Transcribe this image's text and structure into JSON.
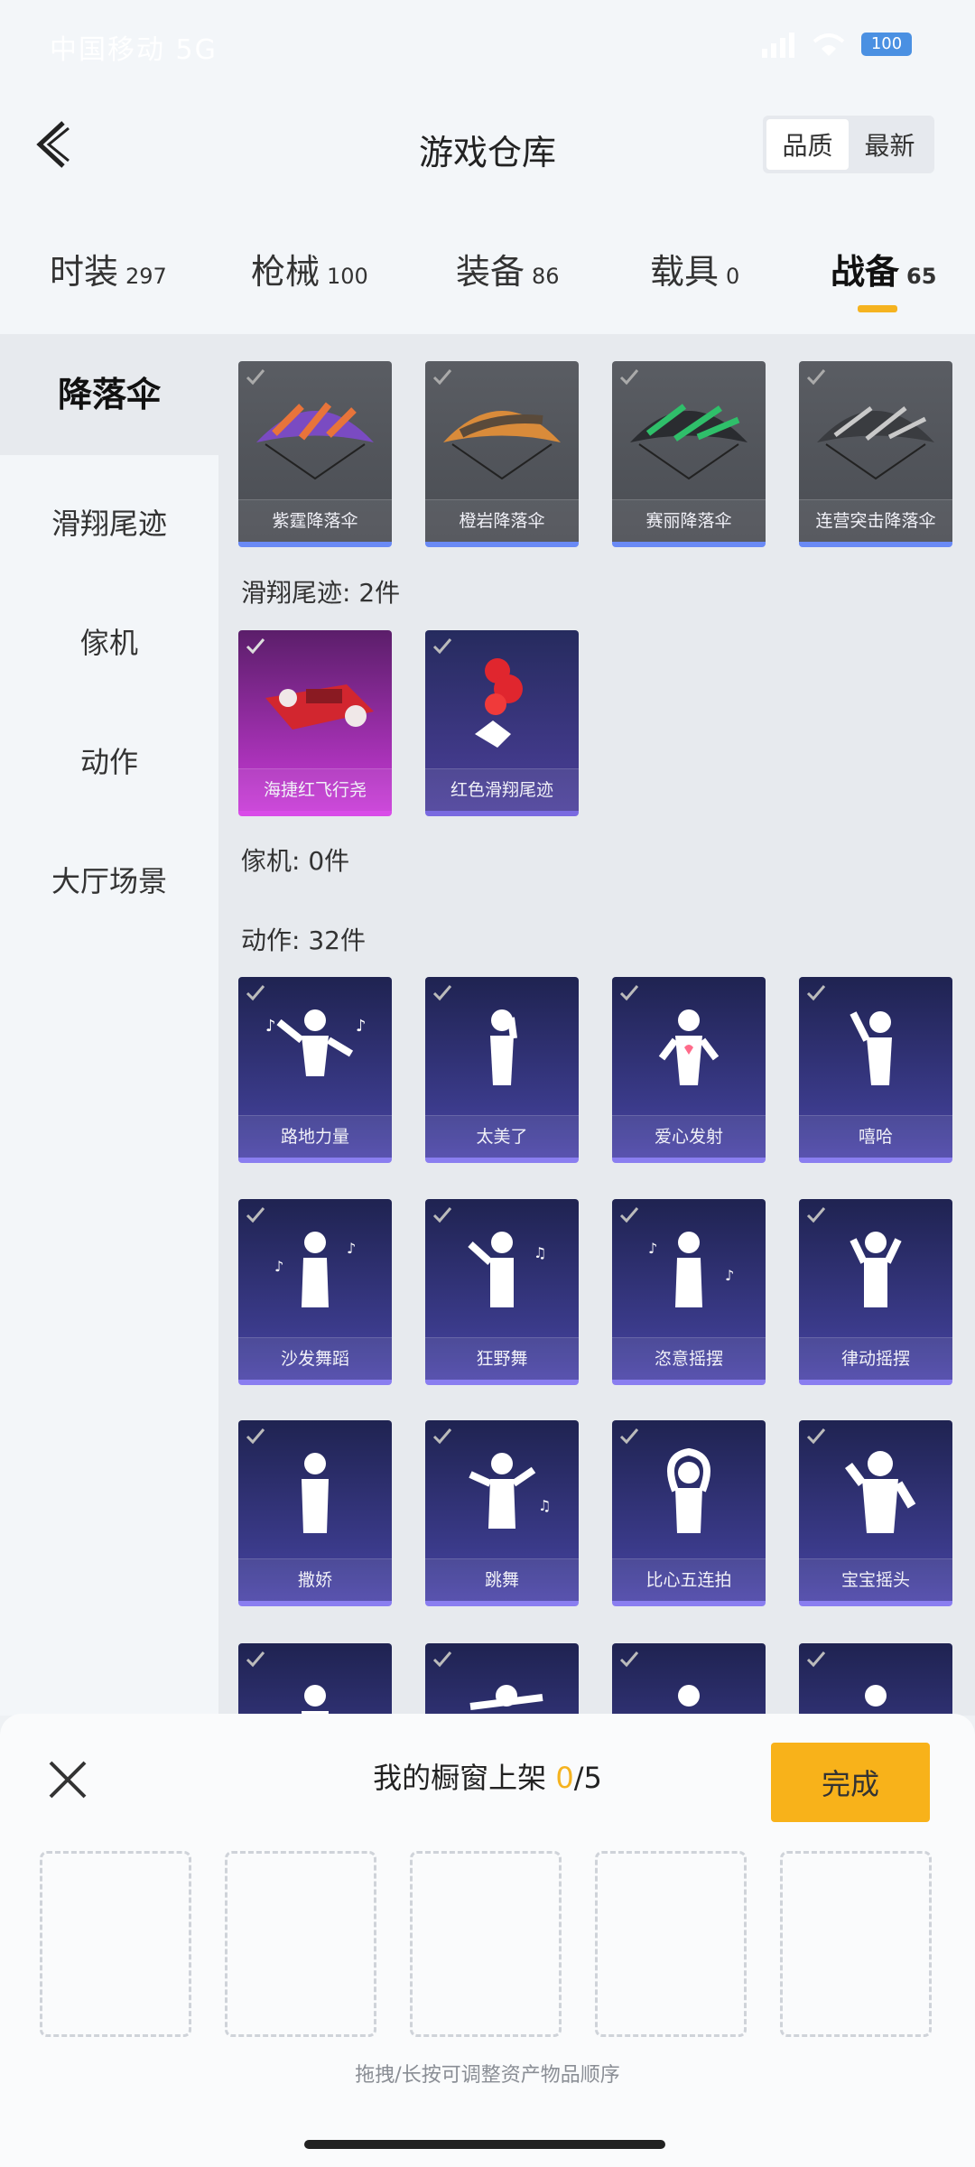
{
  "status": {
    "carrier": "中国移动 5G",
    "battery": "100"
  },
  "header": {
    "title": "游戏仓库",
    "sort": [
      "品质",
      "最新"
    ]
  },
  "categories": [
    {
      "label": "时装",
      "count": "297"
    },
    {
      "label": "枪械",
      "count": "100"
    },
    {
      "label": "装备",
      "count": "86"
    },
    {
      "label": "载具",
      "count": "0"
    },
    {
      "label": "战备",
      "count": "65"
    }
  ],
  "sidebar": [
    "降落伞",
    "滑翔尾迹",
    "傢机",
    "动作",
    "大厅场景"
  ],
  "sections": {
    "trail": "滑翔尾迹: 2件",
    "camera": "傢机: 0件",
    "emote": "动作: 32件"
  },
  "parachutes": [
    "紫霆降落伞",
    "橙岩降落伞",
    "赛丽降落伞",
    "连营突击降落伞"
  ],
  "trails": [
    "海捷红飞行尧",
    "红色滑翔尾迹"
  ],
  "emotes": [
    "路地力量",
    "太美了",
    "爱心发射",
    "嘻哈",
    "沙发舞蹈",
    "狂野舞",
    "恣意摇摆",
    "律动摇摆",
    "撒娇",
    "跳舞",
    "比心五连拍",
    "宝宝摇头"
  ],
  "sheet": {
    "title": "我的橱窗上架",
    "count_current": "0",
    "count_total": "/5",
    "done": "完成",
    "hint": "拖拽/长按可调整资产物品顺序"
  },
  "colors": {
    "accent": "#f5b320",
    "done_bg": "#f8b21a"
  }
}
